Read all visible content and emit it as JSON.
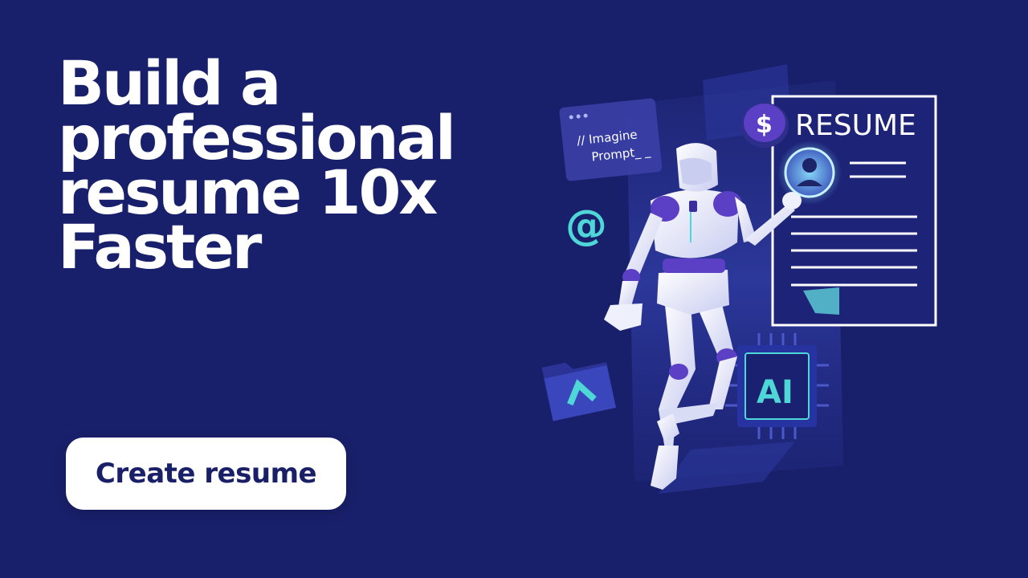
{
  "hero": {
    "headline_lines": [
      "Build a",
      "professional",
      "resume 10x",
      "Faster"
    ]
  },
  "cta": {
    "label": "Create resume"
  },
  "illustration": {
    "prompt_card": {
      "line1": "// Imagine",
      "line2": "Prompt_ _"
    },
    "resume_doc": {
      "title": "RESUME"
    },
    "chip": {
      "label": "AI"
    },
    "coin_symbol": "$",
    "at_symbol": "@",
    "colors": {
      "background": "#19206b",
      "accent_cyan": "#4fd6d6",
      "robot_white": "#eef0fb",
      "robot_purple": "#5b3fc4"
    }
  }
}
